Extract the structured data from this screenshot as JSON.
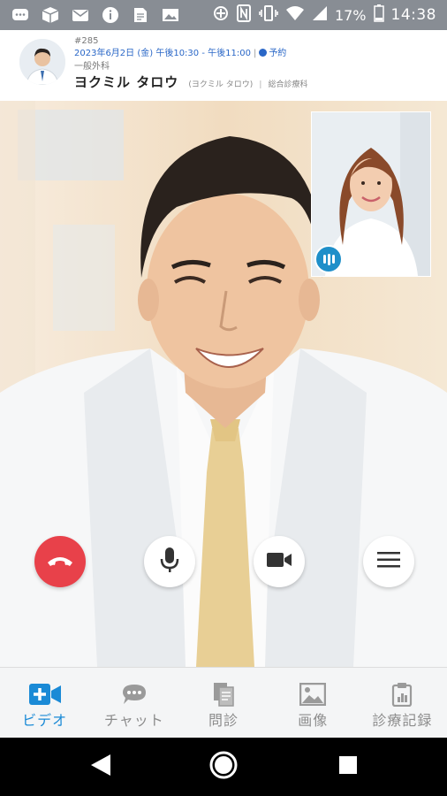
{
  "status_bar": {
    "battery": "17%",
    "time": "14:38",
    "icons_left": [
      "chat-icon",
      "box-icon",
      "mail-icon",
      "info-icon",
      "document-icon",
      "image-icon"
    ],
    "icons_right": [
      "location-icon",
      "nfc-icon",
      "vibrate-icon",
      "wifi-icon",
      "signal-icon",
      "battery-icon"
    ]
  },
  "header": {
    "number": "#285",
    "datetime": "2023年6月2日 (金) 午後10:30 - 午後11:00",
    "status": "予約",
    "department": "一般外科",
    "patient_name": "ヨクミル タロウ",
    "patient_kana": "(ヨクミル タロウ)",
    "doctor_department": "総合診療科"
  },
  "controls": {
    "end_call": "phone-hangup-icon",
    "mic": "microphone-icon",
    "camera": "video-camera-icon",
    "menu": "hamburger-menu-icon"
  },
  "tabs": [
    {
      "label": "ビデオ",
      "icon": "video-plus-icon",
      "active": true
    },
    {
      "label": "チャット",
      "icon": "chat-bubble-icon",
      "active": false
    },
    {
      "label": "問診",
      "icon": "documents-icon",
      "active": false
    },
    {
      "label": "画像",
      "icon": "image-icon",
      "active": false
    },
    {
      "label": "診療記録",
      "icon": "clipboard-chart-icon",
      "active": false
    }
  ],
  "colors": {
    "accent": "#1a8ad6",
    "end_call": "#e8414a",
    "status_bar": "#888d94"
  }
}
